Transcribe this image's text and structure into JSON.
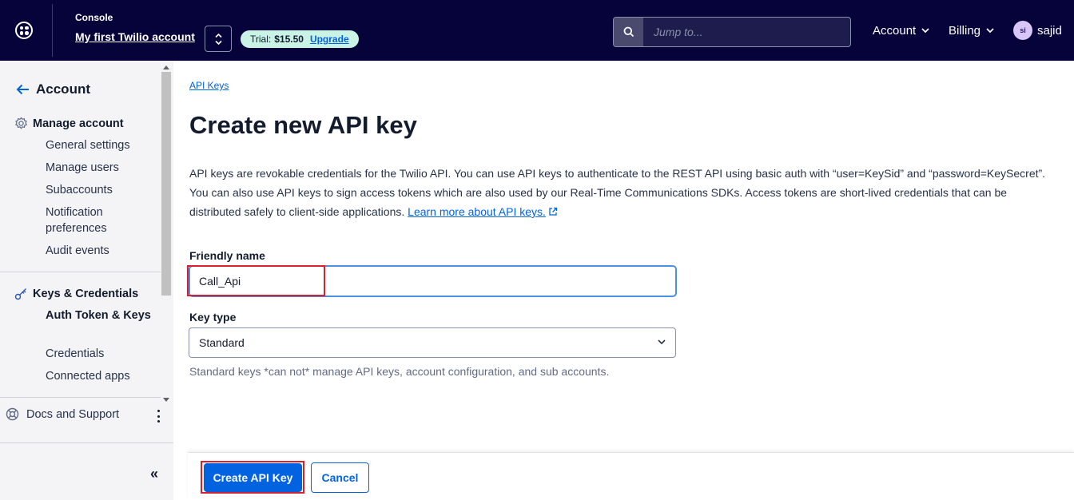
{
  "header": {
    "console_label": "Console",
    "account_name": "My first Twilio account",
    "trial": {
      "prefix": "Trial:",
      "amount": "$15.50",
      "upgrade_label": "Upgrade"
    },
    "search": {
      "placeholder": "Jump to..."
    },
    "nav": {
      "account_label": "Account",
      "billing_label": "Billing"
    },
    "user": {
      "initials": "si",
      "name": "sajid"
    }
  },
  "sidebar": {
    "back_label": "Account",
    "sections": [
      {
        "title": "Manage account",
        "icon": "gear-icon",
        "items": [
          "General settings",
          "Manage users",
          "Subaccounts",
          "Notification preferences",
          "Audit events"
        ]
      },
      {
        "title": "Keys & Credentials",
        "icon": "key-icon",
        "items": [
          "Auth Token & Keys",
          "Credentials",
          "Connected apps"
        ],
        "active_item": "Auth Token & Keys"
      }
    ],
    "docs_label": "Docs and Support",
    "collapse_label": "«"
  },
  "main": {
    "breadcrumb": "API Keys",
    "title": "Create new API key",
    "description": "API keys are revokable credentials for the Twilio API. You can use API keys to authenticate to the REST API using basic auth with “user=KeySid” and “password=KeySecret”. You can also use API keys to sign access tokens which are also used by our Real-Time Communications SDKs. Access tokens are short-lived credentials that can be distributed safely to client-side applications.",
    "learn_more_label": "Learn more about API keys.",
    "form": {
      "friendly_name_label": "Friendly name",
      "friendly_name_value": "Call_Api",
      "key_type_label": "Key type",
      "key_type_value": "Standard",
      "key_type_help": "Standard keys *can not* manage API keys, account configuration, and sub accounts."
    },
    "actions": {
      "create_label": "Create API Key",
      "cancel_label": "Cancel"
    }
  },
  "colors": {
    "header_bg": "#06033a",
    "primary": "#0263e0",
    "trial_badge": "#c9f3e5",
    "highlight": "#d6212e",
    "focus": "#4a90e2"
  }
}
